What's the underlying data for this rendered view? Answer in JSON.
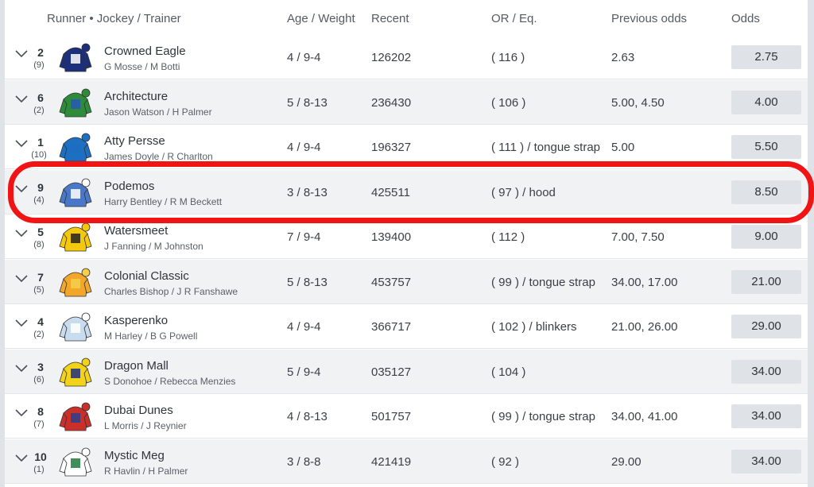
{
  "header": {
    "runner": "Runner • Jockey  /  Trainer",
    "age_weight": "Age / Weight",
    "recent": "Recent",
    "or_eq": "OR / Eq.",
    "previous_odds": "Previous odds",
    "odds": "Odds"
  },
  "runners": [
    {
      "number": "2",
      "draw": "(9)",
      "name": "Crowned Eagle",
      "jockey_trainer": "G Mosse / M Botti",
      "age_weight": "4 / 9-4",
      "recent": "126202",
      "or_eq": "( 116 )",
      "previous_odds": "2.63",
      "odds": "2.75",
      "silk_colors": {
        "body": "#1c2f7a",
        "cap": "#1c2f7a",
        "accent": "#ffffff"
      }
    },
    {
      "number": "6",
      "draw": "(2)",
      "name": "Architecture",
      "jockey_trainer": "Jason Watson / H Palmer",
      "age_weight": "5 / 8-13",
      "recent": "236430",
      "or_eq": "( 106 )",
      "previous_odds": "5.00, 4.50",
      "odds": "4.00",
      "silk_colors": {
        "body": "#2e8b3a",
        "cap": "#2e8b3a",
        "accent": "#2656b8"
      }
    },
    {
      "number": "1",
      "draw": "(10)",
      "name": "Atty Persse",
      "jockey_trainer": "James Doyle / R Charlton",
      "age_weight": "4 / 9-4",
      "recent": "196327",
      "or_eq": "( 111 ) / tongue strap",
      "previous_odds": "5.00",
      "odds": "5.50",
      "silk_colors": {
        "body": "#1d6fc2",
        "cap": "#1d6fc2",
        "accent": "#1d6fc2"
      }
    },
    {
      "number": "9",
      "draw": "(4)",
      "name": "Podemos",
      "jockey_trainer": "Harry Bentley / R M Beckett",
      "age_weight": "3 / 8-13",
      "recent": "425511",
      "or_eq": "( 97 ) / hood",
      "previous_odds": "",
      "odds": "8.50",
      "silk_colors": {
        "body": "#4a78c9",
        "cap": "#ffffff",
        "accent": "#ffffff"
      }
    },
    {
      "number": "5",
      "draw": "(8)",
      "name": "Watersmeet",
      "jockey_trainer": "J Fanning / M Johnston",
      "age_weight": "7 / 9-4",
      "recent": "139400",
      "or_eq": "( 112 )",
      "previous_odds": "7.00, 7.50",
      "odds": "9.00",
      "silk_colors": {
        "body": "#f3c80d",
        "cap": "#f3c80d",
        "accent": "#222222"
      }
    },
    {
      "number": "7",
      "draw": "(5)",
      "name": "Colonial Classic",
      "jockey_trainer": "Charles Bishop / J R Fanshawe",
      "age_weight": "5 / 8-13",
      "recent": "453757",
      "or_eq": "( 99 ) / tongue strap",
      "previous_odds": "34.00, 17.00",
      "odds": "21.00",
      "silk_colors": {
        "body": "#f2a72a",
        "cap": "#f5cf4a",
        "accent": "#f5cf4a"
      }
    },
    {
      "number": "4",
      "draw": "(2)",
      "name": "Kasperenko",
      "jockey_trainer": "M Harley / B G Powell",
      "age_weight": "4 / 9-4",
      "recent": "366717",
      "or_eq": "( 102 ) / blinkers",
      "previous_odds": "21.00, 26.00",
      "odds": "29.00",
      "silk_colors": {
        "body": "#c8dcef",
        "cap": "#ffffff",
        "accent": "#ffffff"
      }
    },
    {
      "number": "3",
      "draw": "(6)",
      "name": "Dragon Mall",
      "jockey_trainer": "S Donohoe / Rebecca Menzies",
      "age_weight": "5 / 9-4",
      "recent": "035127",
      "or_eq": "( 104 )",
      "previous_odds": "",
      "odds": "34.00",
      "silk_colors": {
        "body": "#f3d21a",
        "cap": "#f3d21a",
        "accent": "#1e2f80"
      }
    },
    {
      "number": "8",
      "draw": "(7)",
      "name": "Dubai Dunes",
      "jockey_trainer": "L Morris / J Reynier",
      "age_weight": "4 / 8-13",
      "recent": "501757",
      "or_eq": "( 99 ) / tongue strap",
      "previous_odds": "34.00, 41.00",
      "odds": "34.00",
      "silk_colors": {
        "body": "#c9302a",
        "cap": "#c9302a",
        "accent": "#2b3f8c"
      }
    },
    {
      "number": "10",
      "draw": "(1)",
      "name": "Mystic Meg",
      "jockey_trainer": "R Havlin / H Palmer",
      "age_weight": "3 / 8-8",
      "recent": "421419",
      "or_eq": "( 92 )",
      "previous_odds": "29.00",
      "odds": "34.00",
      "silk_colors": {
        "body": "#ffffff",
        "cap": "#ffffff",
        "accent": "#1e7a3c"
      }
    }
  ],
  "highlight": {
    "runner_number": "9",
    "color": "#f01414"
  },
  "icons": {
    "expand": "chevron-down-icon",
    "silk": "jockey-silk-icon"
  }
}
